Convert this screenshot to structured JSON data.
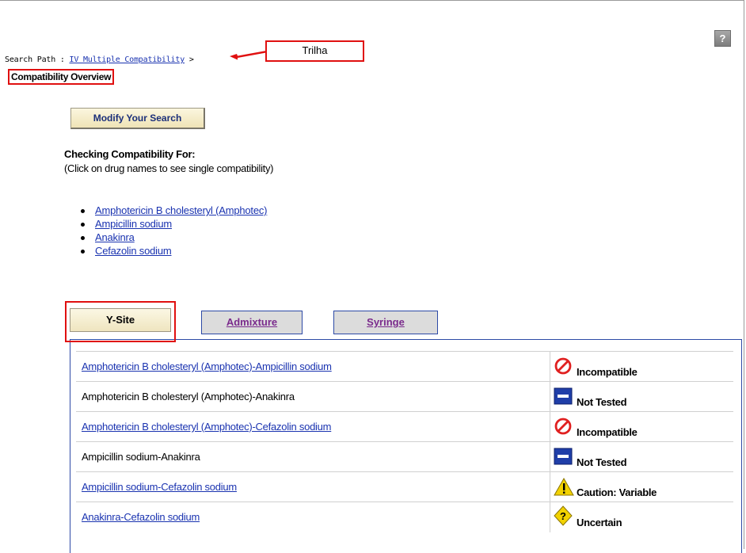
{
  "help_label": "?",
  "search_path": {
    "prefix": "Search Path :",
    "link_label": "IV Multiple Compatibility",
    "separator": ">"
  },
  "annotation_label": "Trilha",
  "page_title": "Compatibility Overview",
  "modify_button": "Modify Your Search",
  "checking": {
    "heading": "Checking Compatibility For:",
    "subtext": "(Click on drug names to see single compatibility)",
    "drugs": [
      "Amphotericin B cholesteryl (Amphotec)",
      "Ampicillin sodium",
      "Anakinra",
      "Cefazolin sodium"
    ]
  },
  "tabs": [
    "Y-Site",
    "Admixture",
    "Syringe"
  ],
  "results": [
    {
      "pair": "Amphotericin B cholesteryl (Amphotec)-Ampicillin sodium",
      "status": "Incompatible",
      "icon": "incompatible-icon"
    },
    {
      "pair": "Amphotericin B cholesteryl (Amphotec)-Anakinra",
      "status": "Not Tested",
      "icon": "not-tested-icon"
    },
    {
      "pair": "Amphotericin B cholesteryl (Amphotec)-Cefazolin sodium",
      "status": "Incompatible",
      "icon": "incompatible-icon"
    },
    {
      "pair": "Ampicillin sodium-Anakinra",
      "status": "Not Tested",
      "icon": "not-tested-icon"
    },
    {
      "pair": "Ampicillin sodium-Cefazolin sodium",
      "status": "Caution: Variable",
      "icon": "caution-icon"
    },
    {
      "pair": "Anakinra-Cefazolin sodium",
      "status": "Uncertain",
      "icon": "uncertain-icon"
    }
  ],
  "colors": {
    "link": "#1a33b0",
    "annotation_red": "#e01010",
    "tab_border": "#2d4aa6",
    "incompatible": "#e02020",
    "not_tested": "#1f3ea8",
    "caution": "#f2d200"
  }
}
